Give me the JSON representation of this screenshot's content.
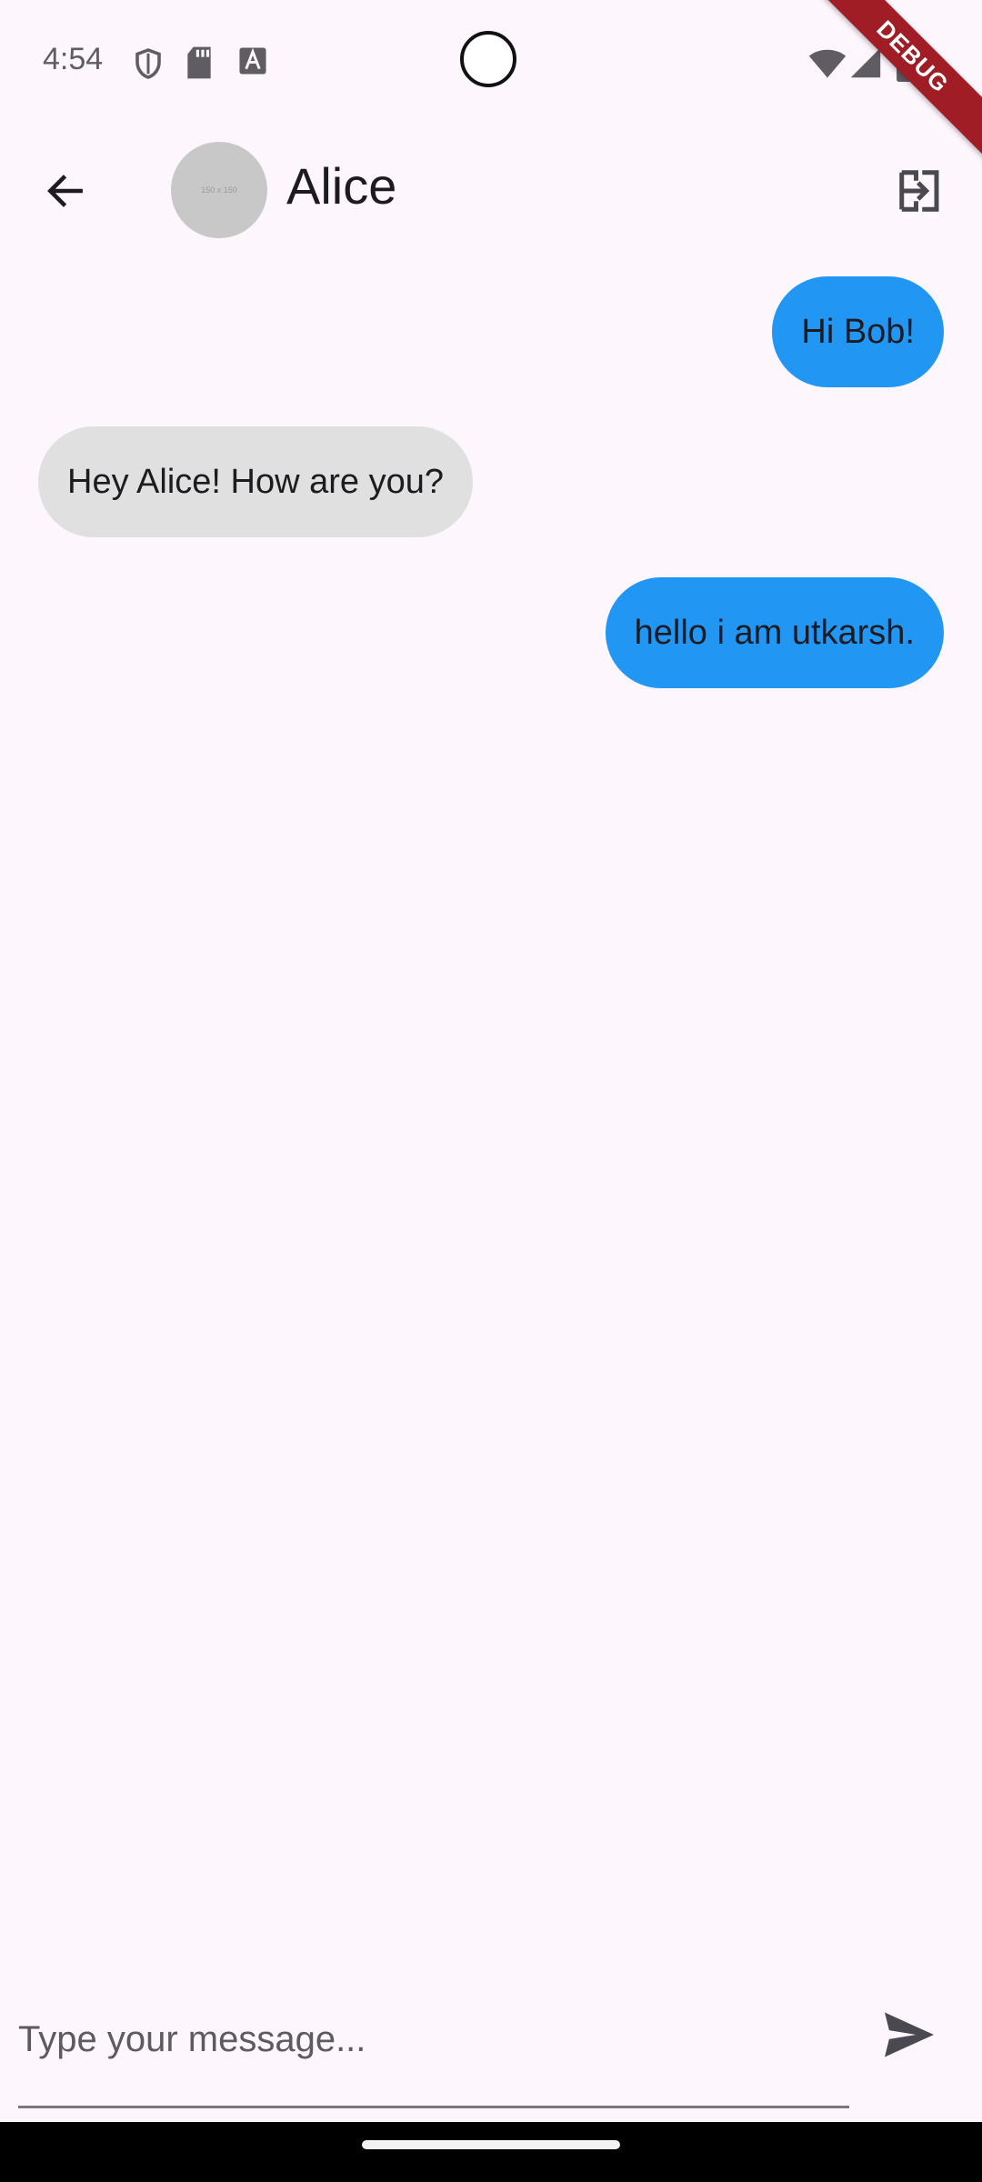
{
  "status_bar": {
    "time": "4:54",
    "icons": [
      "shield-icon",
      "sd-card-icon",
      "font-a-icon",
      "wifi-icon",
      "cellular-signal-icon",
      "battery-icon"
    ]
  },
  "debug_banner": "DEBUG",
  "app_bar": {
    "back_icon": "arrow-back-icon",
    "avatar_placeholder": "150 x 150",
    "title": "Alice",
    "action_icon": "logout-icon"
  },
  "messages": [
    {
      "text": "Hi Bob!",
      "direction": "sent"
    },
    {
      "text": "Hey Alice! How are you?",
      "direction": "received"
    },
    {
      "text": "hello i am utkarsh.",
      "direction": "sent"
    }
  ],
  "composer": {
    "placeholder": "Type your message...",
    "value": "",
    "send_icon": "send-icon"
  },
  "colors": {
    "background": "#fdf6fd",
    "sent_bubble": "#2196f3",
    "received_bubble": "#e0e0e0",
    "debug_ribbon": "#a11d25"
  }
}
